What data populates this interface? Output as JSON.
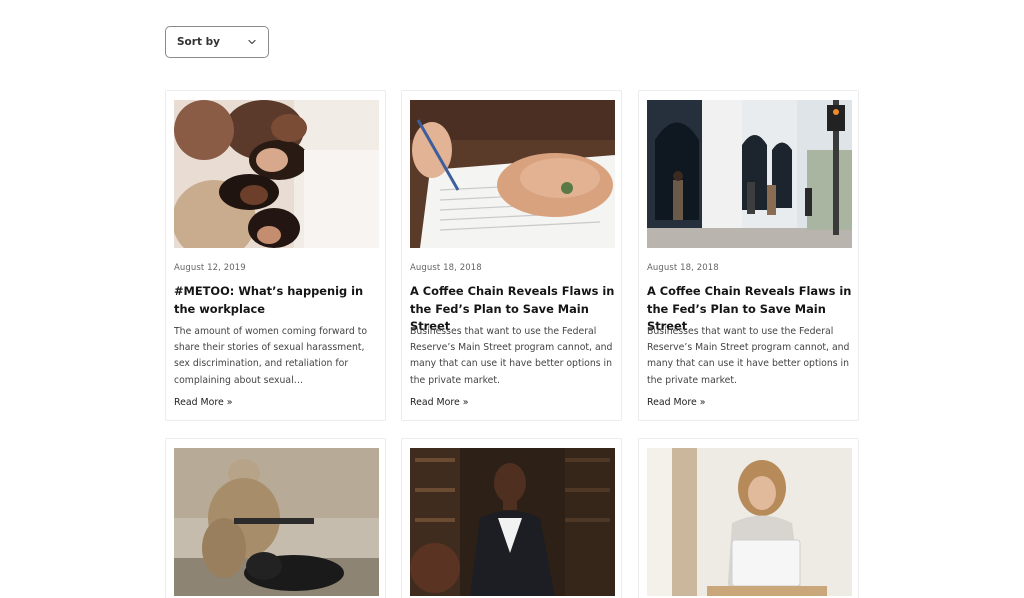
{
  "sort": {
    "label": "Sort by",
    "icon": "chevron-down-icon"
  },
  "colors": {
    "border": "#ececec",
    "text": "#151515",
    "muted": "#666666"
  },
  "posts": [
    {
      "date": "August 12, 2019",
      "title": "#METOO: What’s happenig in the workplace",
      "excerpt": "The amount of women coming forward to share their stories of sexual harassment, sex discrimination, and retaliation for complaining about sexual…",
      "read_more": "Read More »"
    },
    {
      "date": "August 18, 2018",
      "title": "A Coffee Chain Reveals Flaws in the Fed’s Plan to Save Main Street",
      "excerpt": "Businesses that want to use the Federal Reserve’s Main Street program cannot, and many that can use it have better options in the private market.",
      "read_more": "Read More »"
    },
    {
      "date": "August 18, 2018",
      "title": "A Coffee Chain Reveals Flaws in the Fed’s Plan to Save Main Street",
      "excerpt": "Businesses that want to use the Federal Reserve’s Main Street program cannot, and many that can use it have better options in the private market.",
      "read_more": "Read More »"
    },
    {
      "date": "",
      "title": "",
      "excerpt": "",
      "read_more": ""
    },
    {
      "date": "",
      "title": "",
      "excerpt": "",
      "read_more": ""
    },
    {
      "date": "",
      "title": "",
      "excerpt": "",
      "read_more": ""
    }
  ]
}
